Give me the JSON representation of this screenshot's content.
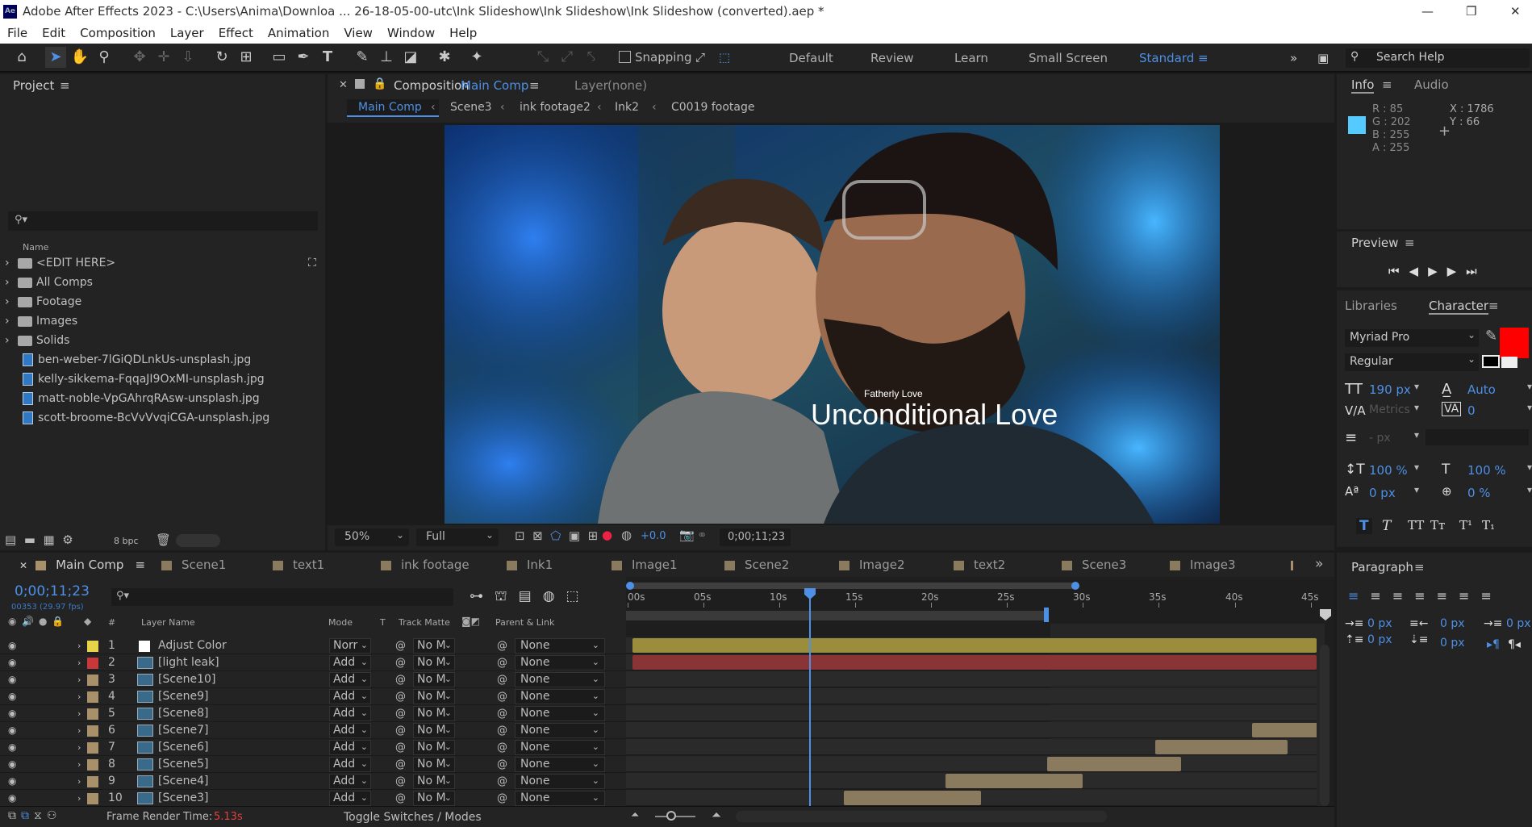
{
  "title": "Adobe After Effects 2023 - C:\\Users\\Anima\\Downloa ... 26-18-05-00-utc\\Ink Slideshow\\Ink Slideshow\\Ink Slideshow (converted).aep *",
  "menu": [
    "File",
    "Edit",
    "Composition",
    "Layer",
    "Effect",
    "Animation",
    "View",
    "Window",
    "Help"
  ],
  "toolbar": {
    "snapping": "Snapping",
    "workspaces": [
      "Default",
      "Review",
      "Learn",
      "Small Screen",
      "Standard"
    ],
    "search": "Search Help"
  },
  "project": {
    "title": "Project",
    "col_name": "Name",
    "items": [
      "<EDIT HERE>",
      "All Comps",
      "Footage",
      "Images",
      "Solids"
    ],
    "files": [
      "ben-weber-7lGiQDLnkUs-unsplash.jpg",
      "kelly-sikkema-FqqaJI9OxMI-unsplash.jpg",
      "matt-noble-VpGAhrqRAsw-unsplash.jpg",
      "scott-broome-BcVvVvqiCGA-unsplash.jpg"
    ],
    "bpc": "8 bpc"
  },
  "comp": {
    "label": "Composition",
    "name": "Main Comp",
    "layer_label": "Layer",
    "layer_value": "(none)",
    "breadcrumbs": [
      "Main Comp",
      "Scene3",
      "ink footage2",
      "Ink2",
      "C0019 footage"
    ],
    "overlay_small": "Fatherly Love",
    "overlay_big": "Unconditional Love",
    "zoom": "50%",
    "quality": "Full",
    "exposure": "+0.0",
    "timecode": "0;00;11;23"
  },
  "info": {
    "tab1": "Info",
    "tab2": "Audio",
    "r": "R : 85",
    "g": "G : 202",
    "b": "B : 255",
    "a": "A : 255",
    "x": "X : 1786",
    "y": "Y : 66",
    "swatch": "#55caff"
  },
  "preview": {
    "title": "Preview"
  },
  "character": {
    "tab1": "Libraries",
    "tab2": "Character",
    "font": "Myriad Pro",
    "style": "Regular",
    "size": "190 px",
    "leading": "Auto",
    "kerning": "Metrics",
    "tracking": "0",
    "stroke": "- px",
    "vscale": "100 %",
    "hscale": "100 %",
    "baseline": "0 px",
    "tsume": "0 %",
    "fill": "#ff0000"
  },
  "paragraph": {
    "title": "Paragraph",
    "v1": "0 px",
    "v2": "0 px",
    "v3": "0 px",
    "v4": "0 px",
    "v5": "0 px"
  },
  "timeline": {
    "tabs": [
      "Main Comp",
      "Scene1",
      "text1",
      "ink footage",
      "Ink1",
      "Image1",
      "Scene2",
      "Image2",
      "text2",
      "Scene3",
      "Image3"
    ],
    "timecode": "0;00;11;23",
    "frames": "00353 (29.97 fps)",
    "cols": [
      "#",
      "Layer Name",
      "Mode",
      "T",
      "Track Matte",
      "Parent & Link"
    ],
    "ruler": [
      "00s",
      "05s",
      "10s",
      "15s",
      "20s",
      "25s",
      "30s",
      "35s",
      "40s",
      "45s"
    ],
    "render_label": "Frame Render Time:",
    "render_value": "5.13s",
    "toggle": "Toggle Switches / Modes",
    "layers": [
      {
        "num": "1",
        "name": "Adjust Color",
        "mode": "Norr",
        "matte": "No M",
        "parent": "None",
        "color": "#e6d34a"
      },
      {
        "num": "2",
        "name": "[light leak]",
        "mode": "Add",
        "matte": "No M",
        "parent": "None",
        "color": "#c8383a"
      },
      {
        "num": "3",
        "name": "[Scene10]",
        "mode": "Add",
        "matte": "No M",
        "parent": "None",
        "color": "#a8906a"
      },
      {
        "num": "4",
        "name": "[Scene9]",
        "mode": "Add",
        "matte": "No M",
        "parent": "None",
        "color": "#a8906a"
      },
      {
        "num": "5",
        "name": "[Scene8]",
        "mode": "Add",
        "matte": "No M",
        "parent": "None",
        "color": "#a8906a"
      },
      {
        "num": "6",
        "name": "[Scene7]",
        "mode": "Add",
        "matte": "No M",
        "parent": "None",
        "color": "#a8906a"
      },
      {
        "num": "7",
        "name": "[Scene6]",
        "mode": "Add",
        "matte": "No M",
        "parent": "None",
        "color": "#a8906a"
      },
      {
        "num": "8",
        "name": "[Scene5]",
        "mode": "Add",
        "matte": "No M",
        "parent": "None",
        "color": "#a8906a"
      },
      {
        "num": "9",
        "name": "[Scene4]",
        "mode": "Add",
        "matte": "No M",
        "parent": "None",
        "color": "#a8906a"
      },
      {
        "num": "10",
        "name": "[Scene3]",
        "mode": "Add",
        "matte": "No M",
        "parent": "None",
        "color": "#a8906a"
      }
    ]
  }
}
